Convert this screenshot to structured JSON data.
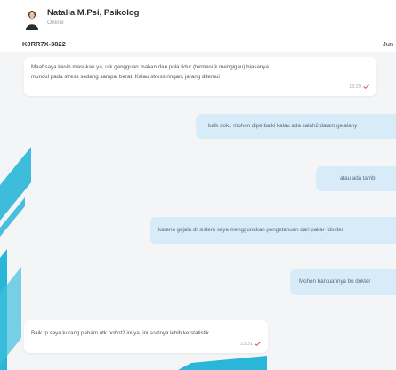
{
  "header": {
    "name": "Natalia M.Psi, Psikolog",
    "status": "Online"
  },
  "subbar": {
    "ticket_id": "K0RR7X-3822",
    "date": "Jun"
  },
  "messages": [
    {
      "line1": "Maaf saya kasih masukan ya, utk gangguan makan dan pola tidur (termasuk mengigau) biasanya",
      "line2": "muncul pada stress sedang sampai berat. Kalau stress ringan, jarang ditemui",
      "time": "13:29"
    },
    {
      "text": "baik dok.. mohon diperbaiki kalau ada salah2 dalam gejalany"
    },
    {
      "text": "atau ada tamb"
    },
    {
      "text": "karena gejala dr sistem saya menggunakan pengetahuan dari pakar (dokter"
    },
    {
      "text": "Mohon bantuannya bu dokter"
    },
    {
      "line1": "Baik tp saya kurang paham utk bobot2 ini ya, ini soalnya lebih ke statistik",
      "time": "13:31"
    }
  ],
  "colors": {
    "accent_stripe": "#29b6d8",
    "outgoing_bubble": "#d7ecf8",
    "read_tick": "#e94b4b"
  },
  "icons": {
    "read_receipt": "checkmark-icon"
  }
}
